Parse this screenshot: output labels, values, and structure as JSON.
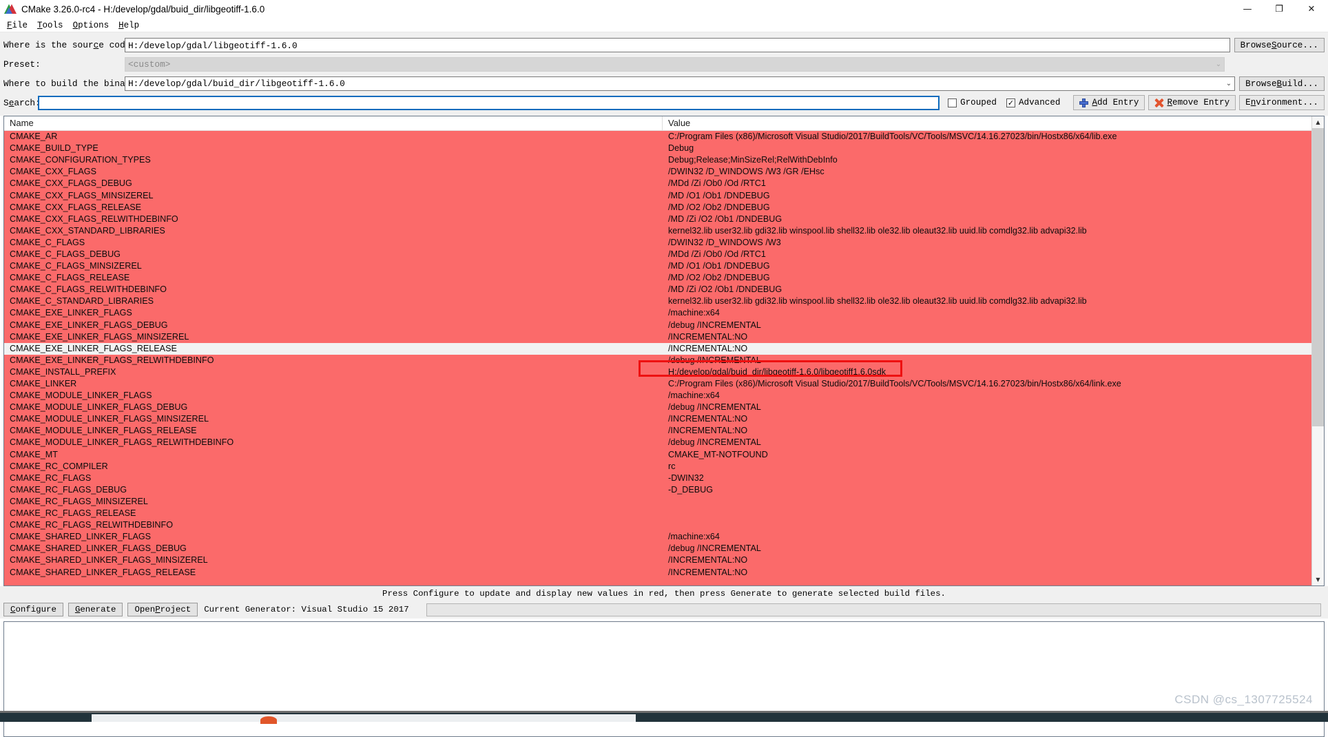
{
  "window": {
    "title": "CMake 3.26.0-rc4 - H:/develop/gdal/buid_dir/libgeotiff-1.6.0",
    "icon": "cmake-logo-icon",
    "minimize": "—",
    "maximize": "❐",
    "close": "✕"
  },
  "menubar": {
    "items": [
      {
        "label": "File",
        "mnemonic": "F"
      },
      {
        "label": "Tools",
        "mnemonic": "T"
      },
      {
        "label": "Options",
        "mnemonic": "O"
      },
      {
        "label": "Help",
        "mnemonic": "H"
      }
    ]
  },
  "form": {
    "source_label": "Where is the source code:",
    "source_value": "H:/develop/gdal/libgeotiff-1.6.0",
    "browse_source_label": "Browse Source...",
    "preset_label": "Preset:",
    "preset_value": "<custom>",
    "build_label": "Where to build the binaries:",
    "build_value": "H:/develop/gdal/buid_dir/libgeotiff-1.6.0",
    "browse_build_label": "Browse Build...",
    "chevron": "⌄"
  },
  "search": {
    "label": "Search:",
    "value": "",
    "placeholder": "",
    "grouped_label": "Grouped",
    "grouped_checked": false,
    "advanced_label": "Advanced",
    "advanced_checked": true,
    "check_glyph": "✓",
    "add_entry_label": "Add Entry",
    "remove_entry_label": "Remove Entry",
    "environment_label": "Environment..."
  },
  "table": {
    "columns": [
      "Name",
      "Value"
    ],
    "selected_row_index": 18,
    "rows": [
      {
        "name": "CMAKE_AR",
        "value": "C:/Program Files (x86)/Microsoft Visual Studio/2017/BuildTools/VC/Tools/MSVC/14.16.27023/bin/Hostx86/x64/lib.exe"
      },
      {
        "name": "CMAKE_BUILD_TYPE",
        "value": "Debug"
      },
      {
        "name": "CMAKE_CONFIGURATION_TYPES",
        "value": "Debug;Release;MinSizeRel;RelWithDebInfo"
      },
      {
        "name": "CMAKE_CXX_FLAGS",
        "value": "/DWIN32 /D_WINDOWS /W3 /GR /EHsc"
      },
      {
        "name": "CMAKE_CXX_FLAGS_DEBUG",
        "value": "/MDd /Zi /Ob0 /Od /RTC1"
      },
      {
        "name": "CMAKE_CXX_FLAGS_MINSIZEREL",
        "value": "/MD /O1 /Ob1 /DNDEBUG"
      },
      {
        "name": "CMAKE_CXX_FLAGS_RELEASE",
        "value": "/MD /O2 /Ob2 /DNDEBUG"
      },
      {
        "name": "CMAKE_CXX_FLAGS_RELWITHDEBINFO",
        "value": "/MD /Zi /O2 /Ob1 /DNDEBUG"
      },
      {
        "name": "CMAKE_CXX_STANDARD_LIBRARIES",
        "value": "kernel32.lib user32.lib gdi32.lib winspool.lib shell32.lib ole32.lib oleaut32.lib uuid.lib comdlg32.lib advapi32.lib"
      },
      {
        "name": "CMAKE_C_FLAGS",
        "value": "/DWIN32 /D_WINDOWS /W3"
      },
      {
        "name": "CMAKE_C_FLAGS_DEBUG",
        "value": "/MDd /Zi /Ob0 /Od /RTC1"
      },
      {
        "name": "CMAKE_C_FLAGS_MINSIZEREL",
        "value": "/MD /O1 /Ob1 /DNDEBUG"
      },
      {
        "name": "CMAKE_C_FLAGS_RELEASE",
        "value": "/MD /O2 /Ob2 /DNDEBUG"
      },
      {
        "name": "CMAKE_C_FLAGS_RELWITHDEBINFO",
        "value": "/MD /Zi /O2 /Ob1 /DNDEBUG"
      },
      {
        "name": "CMAKE_C_STANDARD_LIBRARIES",
        "value": "kernel32.lib user32.lib gdi32.lib winspool.lib shell32.lib ole32.lib oleaut32.lib uuid.lib comdlg32.lib advapi32.lib"
      },
      {
        "name": "CMAKE_EXE_LINKER_FLAGS",
        "value": "/machine:x64"
      },
      {
        "name": "CMAKE_EXE_LINKER_FLAGS_DEBUG",
        "value": "/debug /INCREMENTAL"
      },
      {
        "name": "CMAKE_EXE_LINKER_FLAGS_MINSIZEREL",
        "value": "/INCREMENTAL:NO"
      },
      {
        "name": "CMAKE_EXE_LINKER_FLAGS_RELEASE",
        "value": "/INCREMENTAL:NO"
      },
      {
        "name": "CMAKE_EXE_LINKER_FLAGS_RELWITHDEBINFO",
        "value": "/debug /INCREMENTAL"
      },
      {
        "name": "CMAKE_INSTALL_PREFIX",
        "value": "H:/develop/gdal/buid_dir/libgeotiff-1.6.0/libgeotiff1.6.0sdk"
      },
      {
        "name": "CMAKE_LINKER",
        "value": "C:/Program Files (x86)/Microsoft Visual Studio/2017/BuildTools/VC/Tools/MSVC/14.16.27023/bin/Hostx86/x64/link.exe"
      },
      {
        "name": "CMAKE_MODULE_LINKER_FLAGS",
        "value": "/machine:x64"
      },
      {
        "name": "CMAKE_MODULE_LINKER_FLAGS_DEBUG",
        "value": "/debug /INCREMENTAL"
      },
      {
        "name": "CMAKE_MODULE_LINKER_FLAGS_MINSIZEREL",
        "value": "/INCREMENTAL:NO"
      },
      {
        "name": "CMAKE_MODULE_LINKER_FLAGS_RELEASE",
        "value": "/INCREMENTAL:NO"
      },
      {
        "name": "CMAKE_MODULE_LINKER_FLAGS_RELWITHDEBINFO",
        "value": "/debug /INCREMENTAL"
      },
      {
        "name": "CMAKE_MT",
        "value": "CMAKE_MT-NOTFOUND"
      },
      {
        "name": "CMAKE_RC_COMPILER",
        "value": "rc"
      },
      {
        "name": "CMAKE_RC_FLAGS",
        "value": "-DWIN32"
      },
      {
        "name": "CMAKE_RC_FLAGS_DEBUG",
        "value": "-D_DEBUG"
      },
      {
        "name": "CMAKE_RC_FLAGS_MINSIZEREL",
        "value": ""
      },
      {
        "name": "CMAKE_RC_FLAGS_RELEASE",
        "value": ""
      },
      {
        "name": "CMAKE_RC_FLAGS_RELWITHDEBINFO",
        "value": ""
      },
      {
        "name": "CMAKE_SHARED_LINKER_FLAGS",
        "value": "/machine:x64"
      },
      {
        "name": "CMAKE_SHARED_LINKER_FLAGS_DEBUG",
        "value": "/debug /INCREMENTAL"
      },
      {
        "name": "CMAKE_SHARED_LINKER_FLAGS_MINSIZEREL",
        "value": "/INCREMENTAL:NO"
      },
      {
        "name": "CMAKE_SHARED_LINKER_FLAGS_RELEASE",
        "value": "/INCREMENTAL:NO"
      }
    ]
  },
  "status": {
    "message": "Press Configure to update and display new values in red, then press Generate to generate selected build files."
  },
  "actions": {
    "configure_label": "Configure",
    "generate_label": "Generate",
    "open_project_label": "Open Project",
    "generator_text": "Current Generator: Visual Studio 15 2017"
  },
  "watermark": {
    "text": "CSDN @cs_1307725524"
  },
  "colors": {
    "red_row": "#fb6a6a",
    "annotation": "#ee1111",
    "focus_border": "#0d6bbd",
    "panel": "#f0f0f0"
  }
}
